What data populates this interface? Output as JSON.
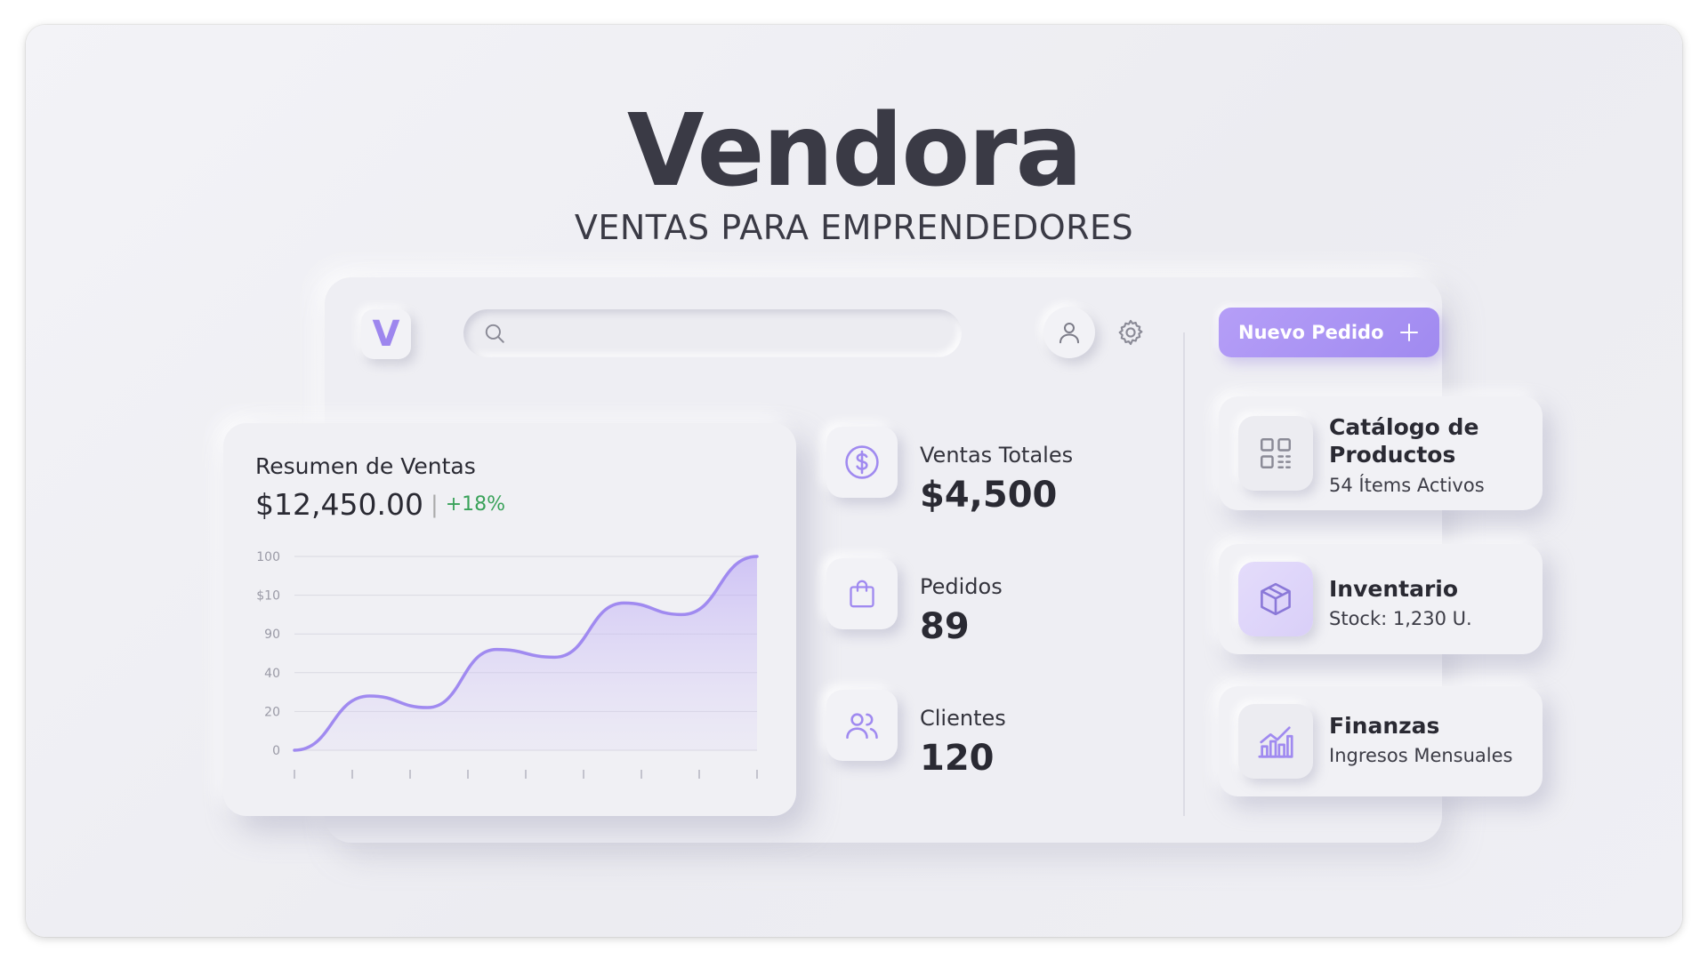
{
  "hero": {
    "title": "Vendora",
    "subtitle": "VENTAS PARA EMPRENDEDORES"
  },
  "header": {
    "logo_letter": "V",
    "search_placeholder": "",
    "new_order_label": "Nuevo Pedido"
  },
  "sales_summary": {
    "title": "Resumen de Ventas",
    "total": "$12,450.00",
    "separator": "|",
    "change": "+18%"
  },
  "stats": [
    {
      "label": "Ventas Totales",
      "value": "$4,500",
      "icon": "dollar-coin-icon"
    },
    {
      "label": "Pedidos",
      "value": "89",
      "icon": "shopping-bag-icon"
    },
    {
      "label": "Clientes",
      "value": "120",
      "icon": "users-icon"
    }
  ],
  "modules": [
    {
      "title_line1": "Catálogo de",
      "title_line2": "Productos",
      "subtitle": "54 Ítems Activos",
      "icon": "grid-icon"
    },
    {
      "title": "Inventario",
      "subtitle": "Stock: 1,230 U.",
      "icon": "box-icon"
    },
    {
      "title": "Finanzas",
      "subtitle": "Ingresos Mensuales",
      "icon": "bar-chart-icon"
    }
  ],
  "colors": {
    "accent": "#a08af0",
    "accent_light": "#b59ef7",
    "positive": "#3aa25a",
    "text": "#2a2a33"
  },
  "chart_data": {
    "type": "area",
    "title": "Resumen de Ventas",
    "y_tick_labels": [
      "0",
      "20",
      "40",
      "90",
      "$10",
      "100"
    ],
    "y": [
      0,
      1.4,
      1.1,
      2.6,
      2.4,
      3.8,
      3.5,
      5.0
    ],
    "x": [
      0,
      1.3,
      2.3,
      3.5,
      4.5,
      5.7,
      6.7,
      8.0
    ],
    "x_tick_count": 9,
    "ylim": [
      0,
      5
    ],
    "xlim": [
      0,
      8
    ],
    "grid": true,
    "legend": false,
    "line_color": "#a08af0"
  }
}
